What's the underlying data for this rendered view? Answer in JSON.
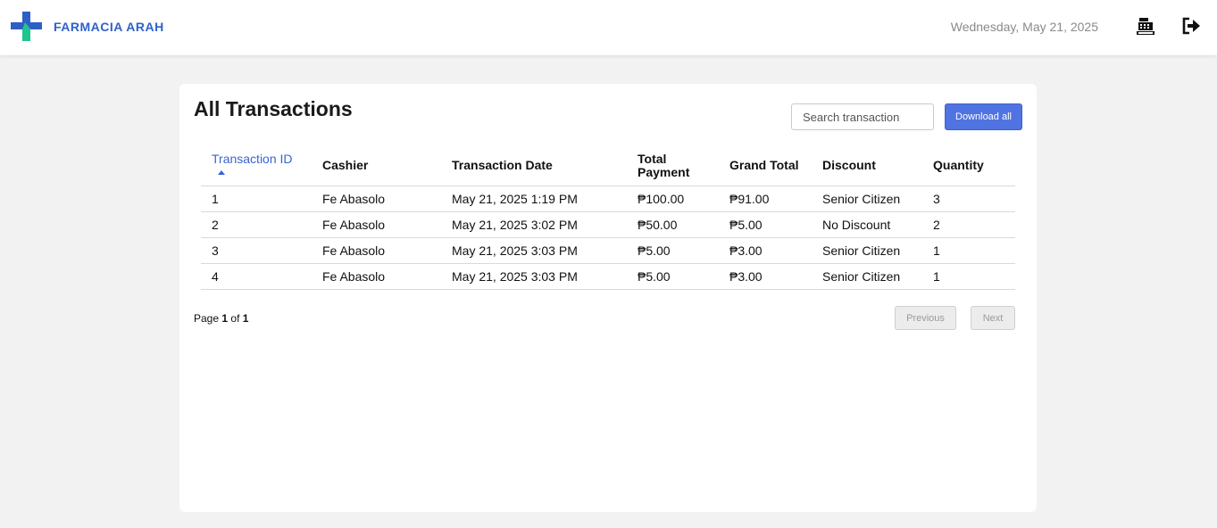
{
  "header": {
    "brand_name": "FARMACIA ARAH",
    "date": "Wednesday, May 21, 2025",
    "icons": {
      "logo": "pharmacy-cross-logo",
      "register": "cash-register-icon",
      "logout": "logout-icon"
    },
    "colors": {
      "brand": "#2f62c9",
      "logo_blue": "#2d5fc4",
      "logo_green": "#1fc58a"
    }
  },
  "main": {
    "title": "All Transactions",
    "search_placeholder": "Search transaction",
    "download_label": "Download all",
    "accent": "#4f73e0",
    "table": {
      "columns": [
        "Transaction ID",
        "Cashier",
        "Transaction Date",
        "Total Payment",
        "Grand Total",
        "Discount",
        "Quantity"
      ],
      "sorted_column": "Transaction ID",
      "sort_direction": "ascending",
      "rows": [
        [
          "1",
          "Fe Abasolo",
          "May 21, 2025 1:19 PM",
          "₱100.00",
          "₱91.00",
          "Senior Citizen",
          "3"
        ],
        [
          "2",
          "Fe Abasolo",
          "May 21, 2025 3:02 PM",
          "₱50.00",
          "₱5.00",
          "No Discount",
          "2"
        ],
        [
          "3",
          "Fe Abasolo",
          "May 21, 2025 3:03 PM",
          "₱5.00",
          "₱3.00",
          "Senior Citizen",
          "1"
        ],
        [
          "4",
          "Fe Abasolo",
          "May 21, 2025 3:03 PM",
          "₱5.00",
          "₱3.00",
          "Senior Citizen",
          "1"
        ]
      ]
    },
    "pagination": {
      "page_label": "Page",
      "current_page": "1",
      "of_label": "of",
      "total_pages": "1",
      "previous_label": "Previous",
      "next_label": "Next"
    }
  }
}
